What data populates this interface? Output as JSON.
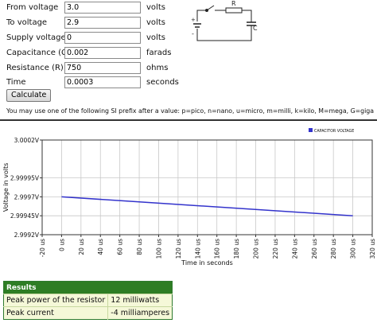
{
  "form": {
    "from_voltage": {
      "label": "From voltage",
      "value": "3.0",
      "unit": "volts"
    },
    "to_voltage": {
      "label": "To voltage",
      "value": "2.9",
      "unit": "volts"
    },
    "supply_voltage": {
      "label": "Supply voltage",
      "value": "0",
      "unit": "volts"
    },
    "capacitance": {
      "label": "Capacitance (C)",
      "value": "0.002",
      "unit": "farads"
    },
    "resistance": {
      "label": "Resistance (R)",
      "value": "750",
      "unit": "ohms"
    },
    "time": {
      "label": "Time",
      "value": "0.0003",
      "unit": "seconds"
    },
    "calculate_label": "Calculate",
    "prefix_note": "You may use one of the following SI prefix after a value: p=pico, n=nano, u=micro, m=milli, k=kilo, M=mega, G=giga"
  },
  "circuit": {
    "resistor_label": "R",
    "capacitor_label": "C",
    "plus_label": "+",
    "minus_label": "-"
  },
  "chart_data": {
    "type": "line",
    "ylabel": "Voltage in volts",
    "xlabel": "Time in seconds",
    "legend_position": "top-right",
    "series": [
      {
        "name": "CAPACITOR VOLTAGE",
        "color": "#3333cc",
        "x": [
          0,
          300
        ],
        "y": [
          2.99996,
          2.99994
        ]
      }
    ],
    "xlim": [
      -20,
      320
    ],
    "ylim": [
      2.99992,
      3.00002
    ],
    "xticks": [
      -20,
      0,
      20,
      40,
      60,
      80,
      100,
      120,
      140,
      160,
      180,
      200,
      220,
      240,
      260,
      280,
      300,
      320
    ],
    "xtick_labels": [
      "-20 us",
      "0 us",
      "20 us",
      "40 us",
      "60 us",
      "80 us",
      "100 us",
      "120 us",
      "140 us",
      "160 us",
      "180 us",
      "200 us",
      "220 us",
      "240 us",
      "260 us",
      "280 us",
      "300 us",
      "320 us"
    ],
    "yticks": [
      2.99992,
      2.99994,
      2.99996,
      2.99998,
      3.00002
    ],
    "ytick_labels": [
      "2.9992V",
      "2.99945V",
      "2.9997V",
      "2.99995V",
      "3.0002V"
    ],
    "grid": true
  },
  "results": {
    "title": "Results",
    "rows": [
      {
        "label": "Peak power of the resistor",
        "value": "12 milliwatts"
      },
      {
        "label": "Peak current",
        "value": "-4 milliamperes"
      }
    ]
  }
}
